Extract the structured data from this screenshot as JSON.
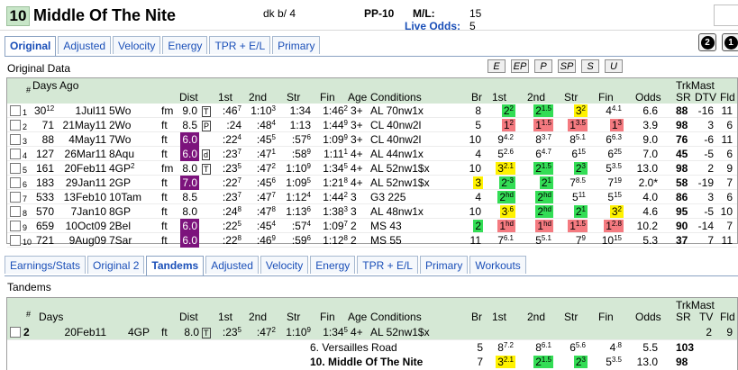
{
  "header": {
    "pp_badge": "10",
    "horse_name": "Middle Of The Nite",
    "dk_label": "dk b/  4",
    "pp_label": "PP-10",
    "ml_label": "M/L:",
    "ml_value": "15",
    "live_odds_label": "Live Odds:",
    "live_odds_value": "5"
  },
  "top_tabs": [
    {
      "label": "Original",
      "active": true
    },
    {
      "label": "Adjusted",
      "active": false
    },
    {
      "label": "Velocity",
      "active": false
    },
    {
      "label": "Energy",
      "active": false
    },
    {
      "label": "TPR + E/L",
      "active": false
    },
    {
      "label": "Primary",
      "active": false
    }
  ],
  "right_buttons": [
    "2",
    "1"
  ],
  "section1_title": "Original Data",
  "filter_buttons": [
    "E",
    "EP",
    "P",
    "SP",
    "S",
    "U"
  ],
  "grid1": {
    "headers": {
      "num": "#",
      "days": "Days Ago",
      "dist": "Dist",
      "first": "1st",
      "second": "2nd",
      "str": "Str",
      "fin": "Fin",
      "age": "Age",
      "conditions": "Conditions",
      "br": "Br",
      "c1st": "1st",
      "c2nd": "2nd",
      "cstr": "Str",
      "cfin": "Fin",
      "odds": "Odds",
      "trkmast": "TrkMast",
      "sr": "SR",
      "dtv": "DTV",
      "fld": "Fld"
    },
    "rows": [
      {
        "n": "1",
        "days": "30",
        "daysSup": "12",
        "date": "1Jul11",
        "race": "5Wo",
        "surf": "fm",
        "dist": "9.0",
        "distStyle": "plain",
        "mark": "T",
        "f1": ":46",
        "f1s": "7",
        "f2": "1:10",
        "f2s": "3",
        "fs": "1:34",
        "fss": "",
        "ff": "1:46",
        "ffs": "2",
        "age": "3+",
        "cond": "AL 70nw1x",
        "br": "8",
        "p1": "2",
        "p1s": "2",
        "p1c": "g",
        "p2": "2",
        "p2s": "1.5",
        "p2c": "g",
        "ps": "3",
        "pss": "2",
        "psc": "y",
        "pf": "4",
        "pfs": "4.1",
        "pfc": "",
        "odds": "6.6",
        "sr": "88",
        "dtv": "-16",
        "fld": "11"
      },
      {
        "n": "2",
        "days": "71",
        "daysSup": "",
        "date": "21May11",
        "race": "2Wo",
        "surf": "ft",
        "dist": "8.5",
        "distStyle": "plain",
        "mark": "P",
        "f1": ":24",
        "f1s": "",
        "f2": ":48",
        "f2s": "4",
        "fs": "1:13",
        "fss": "",
        "ff": "1:44",
        "ffs": "9",
        "age": "3+",
        "cond": "CL 40nw2l",
        "br": "5",
        "p1": "1",
        "p1s": "2",
        "p1c": "p",
        "p2": "1",
        "p2s": "1.5",
        "p2c": "p",
        "ps": "1",
        "pss": "3.5",
        "psc": "p",
        "pf": "1",
        "pfs": "3",
        "pfc": "p",
        "odds": "3.9",
        "sr": "98",
        "dtv": "3",
        "fld": "6"
      },
      {
        "n": "3",
        "days": "88",
        "daysSup": "",
        "date": "4May11",
        "race": "7Wo",
        "surf": "ft",
        "dist": "6.0",
        "distStyle": "purple",
        "mark": "",
        "f1": ":22",
        "f1s": "4",
        "f2": ":45",
        "f2s": "5",
        "fs": ":57",
        "fss": "6",
        "ff": "1:09",
        "ffs": "9",
        "age": "3+",
        "cond": "CL 40nw2l",
        "br": "10",
        "p1": "9",
        "p1s": "4.2",
        "p1c": "",
        "p2": "8",
        "p2s": "3.7",
        "p2c": "",
        "ps": "8",
        "pss": "5.1",
        "psc": "",
        "pf": "6",
        "pfs": "6.3",
        "pfc": "",
        "odds": "9.0",
        "sr": "76",
        "dtv": "-6",
        "fld": "11"
      },
      {
        "n": "4",
        "days": "127",
        "daysSup": "",
        "date": "26Mar11",
        "race": "8Aqu",
        "surf": "ft",
        "dist": "6.0",
        "distStyle": "purple",
        "mark": "d",
        "f1": ":23",
        "f1s": "7",
        "f2": ":47",
        "f2s": "1",
        "fs": ":58",
        "fss": "9",
        "ff": "1:11",
        "ffs": "1",
        "age": "4+",
        "cond": "AL 44nw1x",
        "br": "4",
        "p1": "5",
        "p1s": "2.6",
        "p1c": "",
        "p2": "6",
        "p2s": "4.7",
        "p2c": "",
        "ps": "6",
        "pss": "15",
        "psc": "",
        "pf": "6",
        "pfs": "25",
        "pfc": "",
        "odds": "7.0",
        "sr": "45",
        "dtv": "-5",
        "fld": "6"
      },
      {
        "n": "5",
        "days": "161",
        "daysSup": "",
        "date": "20Feb11",
        "race": "4GP",
        "raceSup": "2",
        "surf": "fm",
        "dist": "8.0",
        "distStyle": "plain",
        "mark": "T",
        "f1": ":23",
        "f1s": "5",
        "f2": ":47",
        "f2s": "2",
        "fs": "1:10",
        "fss": "9",
        "ff": "1:34",
        "ffs": "5",
        "age": "4+",
        "cond": "AL 52nw1$x",
        "br": "10",
        "p1": "3",
        "p1s": "2.1",
        "p1c": "y",
        "p2": "2",
        "p2s": "1.5",
        "p2c": "g",
        "ps": "2",
        "pss": "3",
        "psc": "g",
        "pf": "5",
        "pfs": "3.5",
        "pfc": "",
        "odds": "13.0",
        "sr": "98",
        "dtv": "2",
        "fld": "9"
      },
      {
        "n": "6",
        "days": "183",
        "daysSup": "",
        "date": "29Jan11",
        "race": "2GP",
        "surf": "ft",
        "dist": "7.0",
        "distStyle": "purple",
        "mark": "",
        "f1": ":22",
        "f1s": "7",
        "f2": ":45",
        "f2s": "6",
        "fs": "1:09",
        "fss": "5",
        "ff": "1:21",
        "ffs": "8",
        "age": "4+",
        "cond": "AL 52nw1$x",
        "br": "3",
        "brc": "y",
        "p1": "2",
        "p1s": "-3",
        "p1c": "g",
        "p2": "2",
        "p2s": "1",
        "p2c": "g",
        "ps": "7",
        "pss": "8.5",
        "psc": "",
        "pf": "7",
        "pfs": "19",
        "pfc": "",
        "odds": "2.0*",
        "sr": "58",
        "dtv": "-19",
        "fld": "7"
      },
      {
        "n": "7",
        "days": "533",
        "daysSup": "",
        "date": "13Feb10",
        "race": "10Tam",
        "surf": "ft",
        "dist": "8.5",
        "distStyle": "plain",
        "mark": "",
        "f1": ":23",
        "f1s": "7",
        "f2": ":47",
        "f2s": "7",
        "fs": "1:12",
        "fss": "4",
        "ff": "1:44",
        "ffs": "2",
        "age": "3",
        "cond": "G3 225",
        "br": "4",
        "p1": "2",
        "p1s": "hd",
        "p1c": "g",
        "p2": "2",
        "p2s": "hd",
        "p2c": "g",
        "ps": "5",
        "pss": "11",
        "psc": "",
        "pf": "5",
        "pfs": "15",
        "pfc": "",
        "odds": "4.0",
        "sr": "86",
        "dtv": "3",
        "fld": "6"
      },
      {
        "n": "8",
        "days": "570",
        "daysSup": "",
        "date": "7Jan10",
        "race": "8GP",
        "surf": "ft",
        "dist": "8.0",
        "distStyle": "plain",
        "mark": "",
        "f1": ":24",
        "f1s": "8",
        "f2": ":47",
        "f2s": "8",
        "fs": "1:13",
        "fss": "6",
        "ff": "1:38",
        "ffs": "3",
        "age": "3",
        "cond": "AL 48nw1x",
        "br": "10",
        "p1": "3",
        "p1s": ".6",
        "p1c": "y",
        "p2": "2",
        "p2s": "hd",
        "p2c": "g",
        "ps": "2",
        "pss": "1",
        "psc": "g",
        "pf": "3",
        "pfs": "2",
        "pfc": "y",
        "odds": "4.6",
        "sr": "95",
        "dtv": "-5",
        "fld": "10"
      },
      {
        "n": "9",
        "days": "659",
        "daysSup": "",
        "date": "10Oct09",
        "race": "2Bel",
        "surf": "ft",
        "dist": "6.0",
        "distStyle": "purple",
        "mark": "",
        "f1": ":22",
        "f1s": "5",
        "f2": ":45",
        "f2s": "4",
        "fs": ":57",
        "fss": "4",
        "ff": "1:09",
        "ffs": "7",
        "age": "2",
        "cond": "MS 43",
        "br": "2",
        "brc": "g",
        "p1": "1",
        "p1s": "hd",
        "p1c": "p",
        "p2": "1",
        "p2s": "hd",
        "p2c": "p",
        "ps": "1",
        "pss": "1.5",
        "psc": "p",
        "pf": "1",
        "pfs": "2.8",
        "pfc": "p",
        "odds": "10.2",
        "sr": "90",
        "dtv": "-14",
        "fld": "7"
      },
      {
        "n": "10",
        "days": "721",
        "daysSup": "",
        "date": "9Aug09",
        "race": "7Sar",
        "surf": "ft",
        "dist": "6.0",
        "distStyle": "purple",
        "mark": "",
        "f1": ":22",
        "f1s": "8",
        "f2": ":46",
        "f2s": "9",
        "fs": ":59",
        "fss": "6",
        "ff": "1:12",
        "ffs": "8",
        "age": "2",
        "cond": "MS 55",
        "br": "11",
        "p1": "7",
        "p1s": "6.1",
        "p1c": "",
        "p2": "5",
        "p2s": "5.1",
        "p2c": "",
        "ps": "7",
        "pss": "9",
        "psc": "",
        "pf": "10",
        "pfs": "15",
        "pfc": "",
        "odds": "5.3",
        "sr": "37",
        "dtv": "7",
        "fld": "11"
      }
    ]
  },
  "bottom_tabs": [
    {
      "label": "Earnings/Stats",
      "active": false
    },
    {
      "label": "Original 2",
      "active": false
    },
    {
      "label": "Tandems",
      "active": true
    },
    {
      "label": "Adjusted",
      "active": false
    },
    {
      "label": "Velocity",
      "active": false
    },
    {
      "label": "Energy",
      "active": false
    },
    {
      "label": "TPR + E/L",
      "active": false
    },
    {
      "label": "Primary",
      "active": false
    },
    {
      "label": "Workouts",
      "active": false
    }
  ],
  "section2_title": "Tandems",
  "grid2": {
    "headers": {
      "num": "#",
      "days": "Days",
      "dist": "Dist",
      "first": "1st",
      "second": "2nd",
      "str": "Str",
      "fin": "Fin",
      "age": "Age",
      "conditions": "Conditions",
      "br": "Br",
      "c1st": "1st",
      "c2nd": "2nd",
      "cstr": "Str",
      "cfin": "Fin",
      "odds": "Odds",
      "trkmast": "TrkMast",
      "sr": "SR",
      "tv": "TV",
      "fld": "Fld"
    },
    "main_row": {
      "n": "2",
      "date": "20Feb11",
      "race": "4GP",
      "surf": "ft",
      "dist": "8.0",
      "mark": "T",
      "f1": ":23",
      "f1s": "5",
      "f2": ":47",
      "f2s": "2",
      "fs": "1:10",
      "fss": "9",
      "ff": "1:34",
      "ffs": "5",
      "age": "4+",
      "cond": "AL 52nw1$x",
      "tv": "2",
      "fld": "9"
    },
    "sub_rows": [
      {
        "label": "6.  Versailles Road",
        "bold": false,
        "br": "5",
        "p1": "8",
        "p1s": "7.2",
        "p1c": "",
        "p2": "8",
        "p2s": "6.1",
        "p2c": "",
        "ps": "6",
        "pss": "5.6",
        "psc": "",
        "pf": "4",
        "pfs": ".8",
        "pfc": "",
        "odds": "5.5",
        "sr": "103"
      },
      {
        "label": "10.  Middle Of The Nite",
        "bold": true,
        "br": "7",
        "p1": "3",
        "p1s": "2.1",
        "p1c": "y",
        "p2": "2",
        "p2s": "1.5",
        "p2c": "g",
        "ps": "2",
        "pss": "3",
        "psc": "g",
        "pf": "5",
        "pfs": "3.5",
        "pfc": "",
        "odds": "13.0",
        "sr": "98"
      }
    ]
  }
}
